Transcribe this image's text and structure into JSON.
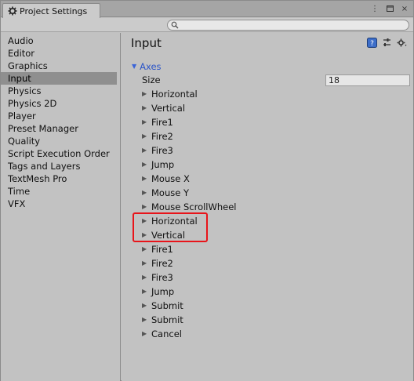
{
  "window": {
    "tab_label": "Project Settings",
    "controls": [
      "⋮",
      "▫",
      "×"
    ]
  },
  "search": {
    "placeholder": "",
    "value": ""
  },
  "sidebar": {
    "items": [
      {
        "label": "Audio",
        "selected": false
      },
      {
        "label": "Editor",
        "selected": false
      },
      {
        "label": "Graphics",
        "selected": false
      },
      {
        "label": "Input",
        "selected": true
      },
      {
        "label": "Physics",
        "selected": false
      },
      {
        "label": "Physics 2D",
        "selected": false
      },
      {
        "label": "Player",
        "selected": false
      },
      {
        "label": "Preset Manager",
        "selected": false
      },
      {
        "label": "Quality",
        "selected": false
      },
      {
        "label": "Script Execution Order",
        "selected": false
      },
      {
        "label": "Tags and Layers",
        "selected": false
      },
      {
        "label": "TextMesh Pro",
        "selected": false
      },
      {
        "label": "Time",
        "selected": false
      },
      {
        "label": "VFX",
        "selected": false
      }
    ]
  },
  "main": {
    "title": "Input",
    "header_icons": [
      "help-book-icon",
      "preset-sliders-icon",
      "settings-gear-icon"
    ],
    "axes_label": "Axes",
    "size_label": "Size",
    "size_value": "18",
    "axes": [
      "Horizontal",
      "Vertical",
      "Fire1",
      "Fire2",
      "Fire3",
      "Jump",
      "Mouse X",
      "Mouse Y",
      "Mouse ScrollWheel",
      "Horizontal",
      "Vertical",
      "Fire1",
      "Fire2",
      "Fire3",
      "Jump",
      "Submit",
      "Submit",
      "Cancel"
    ]
  },
  "colors": {
    "axes_link": "#2a54c8",
    "highlight": "#e8141a",
    "selected_row": "#8f8f8f",
    "panel_bg": "#c2c2c2"
  }
}
